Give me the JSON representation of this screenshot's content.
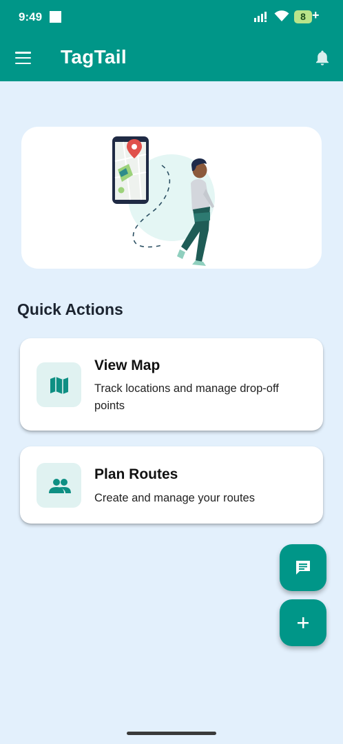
{
  "status_bar": {
    "time": "9:49",
    "battery": "8",
    "battery_suffix": "+"
  },
  "app_bar": {
    "title": "TagTail",
    "menu_icon": "menu-icon",
    "notification_icon": "bell-icon"
  },
  "hero": {
    "illustration": "person-walking-with-map-pin-phone"
  },
  "quick_actions": {
    "title": "Quick Actions",
    "items": [
      {
        "title": "View Map",
        "description": "Track locations and manage drop-off points",
        "icon": "map-icon"
      },
      {
        "title": "Plan Routes",
        "description": "Create and manage your routes",
        "icon": "people-icon"
      }
    ]
  },
  "fabs": [
    {
      "icon": "chat-icon"
    },
    {
      "icon": "add-icon"
    }
  ],
  "colors": {
    "primary": "#009688",
    "background": "#e3f0fc",
    "icon_tile": "#e0f2f1",
    "card": "#ffffff"
  }
}
